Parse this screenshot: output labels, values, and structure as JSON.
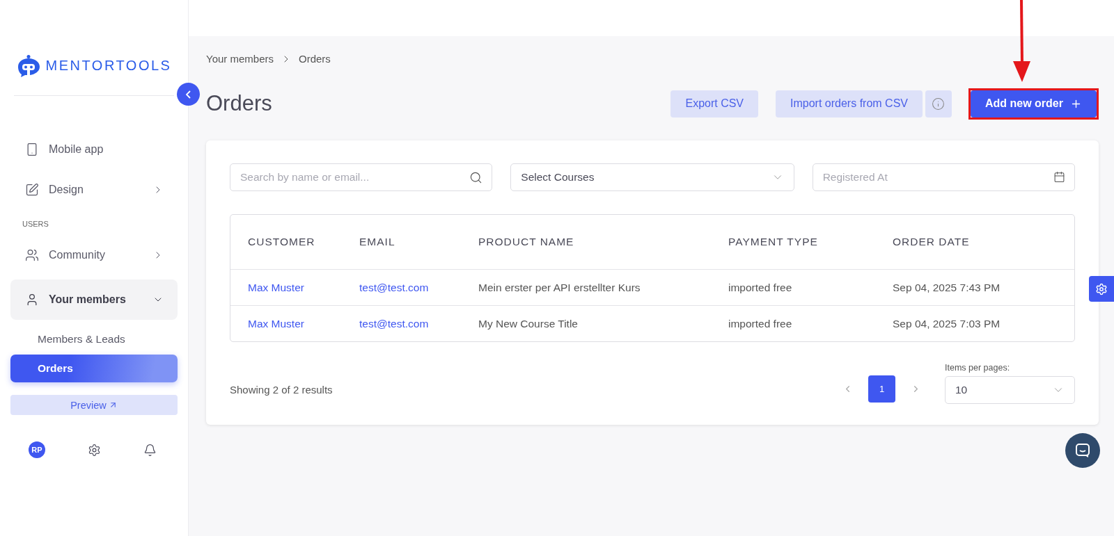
{
  "logo": {
    "text": "MENTORTOOLS"
  },
  "sidebar": {
    "sections": [
      {
        "items": [
          {
            "kind": "link",
            "label": "Mobile app"
          },
          {
            "kind": "group",
            "label": "Design",
            "expanded": false
          }
        ]
      },
      {
        "heading": "USERS",
        "items": [
          {
            "kind": "group",
            "label": "Community",
            "expanded": false
          },
          {
            "kind": "group",
            "label": "Your members",
            "expanded": true,
            "children": [
              {
                "label": "Members & Leads",
                "selected": false
              },
              {
                "label": "Orders",
                "selected": true
              }
            ]
          }
        ]
      }
    ],
    "preview": {
      "label": "Preview"
    },
    "avatar": {
      "initials": "RP"
    }
  },
  "breadcrumb": [
    "Your members",
    "Orders"
  ],
  "title": "Orders",
  "actions": [
    {
      "kind": "secondary",
      "label": "Export CSV"
    },
    {
      "kind": "secondary",
      "label": "Import orders from CSV"
    },
    {
      "kind": "info"
    },
    {
      "kind": "primary",
      "label": "Add new order"
    }
  ],
  "filters": {
    "search": {
      "placeholder": "Search by name or email..."
    },
    "courses": {
      "value": "Select Courses"
    },
    "date": {
      "placeholder": "Registered At"
    }
  },
  "table": {
    "columns": [
      "CUSTOMER",
      "EMAIL",
      "PRODUCT NAME",
      "PAYMENT TYPE",
      "ORDER DATE"
    ],
    "rows": [
      [
        "Max Muster",
        "test@test.com",
        "Mein erster per API erstellter Kurs",
        "imported free",
        "Sep 04, 2025 7:43 PM"
      ],
      [
        "Max Muster",
        "test@test.com",
        "My New Course Title",
        "imported free",
        "Sep 04, 2025 7:03 PM"
      ]
    ]
  },
  "footer": {
    "summary": "Showing 2 of 2 results",
    "pages": [
      {
        "label": "1",
        "selected": true
      }
    ],
    "per_page": {
      "label": "Items per pages:",
      "value": "10"
    }
  }
}
